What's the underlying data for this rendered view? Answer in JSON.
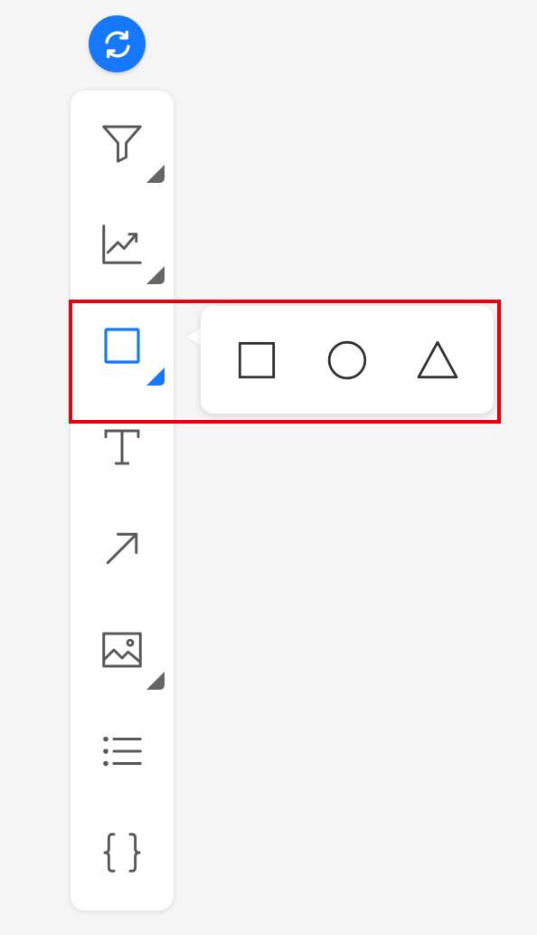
{
  "sync_button": {
    "icon": "refresh-icon",
    "color": "#1677ff"
  },
  "toolbar": {
    "tools": [
      {
        "name": "filter",
        "icon": "filter-icon",
        "active": false,
        "has_submenu": true
      },
      {
        "name": "chart",
        "icon": "line-chart-icon",
        "active": false,
        "has_submenu": true
      },
      {
        "name": "shape",
        "icon": "square-icon",
        "active": true,
        "has_submenu": true
      },
      {
        "name": "text",
        "icon": "text-icon",
        "active": false,
        "has_submenu": false
      },
      {
        "name": "arrow",
        "icon": "arrow-icon",
        "active": false,
        "has_submenu": false
      },
      {
        "name": "image",
        "icon": "image-icon",
        "active": false,
        "has_submenu": true
      },
      {
        "name": "list",
        "icon": "list-icon",
        "active": false,
        "has_submenu": false
      },
      {
        "name": "code",
        "icon": "braces-icon",
        "active": false,
        "has_submenu": false
      }
    ]
  },
  "shape_popover": {
    "options": [
      {
        "name": "rectangle",
        "icon": "rectangle-icon"
      },
      {
        "name": "ellipse",
        "icon": "circle-icon"
      },
      {
        "name": "triangle",
        "icon": "triangle-icon"
      }
    ]
  },
  "colors": {
    "accent": "#1677ff",
    "icon": "#595959",
    "highlight": "#e8000b"
  }
}
